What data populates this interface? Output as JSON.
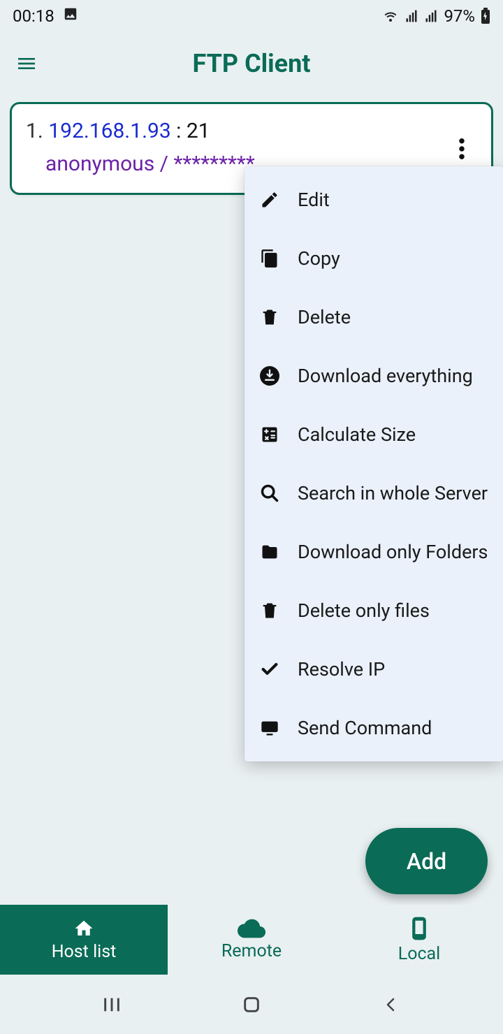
{
  "status": {
    "time": "00:18",
    "battery_pct": "97%"
  },
  "header": {
    "title": "FTP Client"
  },
  "host": {
    "index": "1.",
    "ip": "192.168.1.93",
    "port_sep": " : ",
    "port": "21",
    "user": "anonymous",
    "user_sep": " / ",
    "pass": "*********"
  },
  "menu": {
    "edit": "Edit",
    "copy": "Copy",
    "delete": "Delete",
    "download_all": "Download everything",
    "calc_size": "Calculate Size",
    "search_server": "Search in whole Server",
    "download_folders": "Download only Folders",
    "delete_files": "Delete only files",
    "resolve_ip": "Resolve IP",
    "send_cmd": "Send Command"
  },
  "fab": {
    "label": "Add"
  },
  "tabs": {
    "host_list": "Host list",
    "remote": "Remote",
    "local": "Local"
  }
}
